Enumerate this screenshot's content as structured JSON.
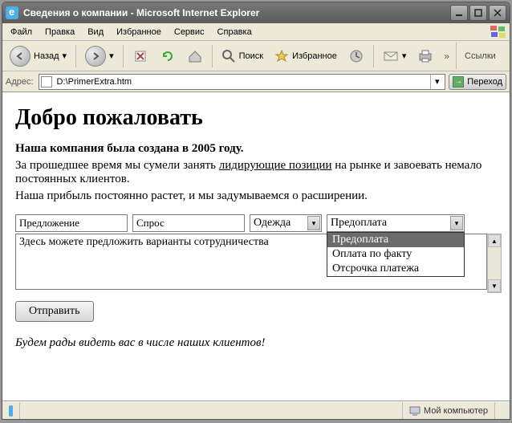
{
  "window": {
    "title": "Сведения о компании - Microsoft Internet Explorer"
  },
  "menu": {
    "file": "Файл",
    "edit": "Правка",
    "view": "Вид",
    "favorites": "Избранное",
    "service": "Сервис",
    "help": "Справка"
  },
  "toolbar": {
    "back": "Назад",
    "search": "Поиск",
    "favorites": "Избранное",
    "links": "Ссылки"
  },
  "address": {
    "label": "Адрес:",
    "value": "D:\\PrimerExtra.htm",
    "go": "Переход"
  },
  "page": {
    "heading": "Добро пожаловать",
    "sub_bold": "Наша компания была создана в 2005 году.",
    "line2a": "За прошедшее время мы сумели занять ",
    "line2u": "лидирующие позиции",
    "line2b": " на рынке и завоевать немало постоянных клиентов.",
    "line3": "Наша прибыль постоянно растет, и мы задумываемся о расширении.",
    "offer_value": "Предложение",
    "demand_value": "Спрос",
    "clothes_selected": "Одежда",
    "payment_selected": "Предоплата",
    "payment_options": [
      "Предоплата",
      "Оплата по факту",
      "Отсрочка платежа"
    ],
    "textarea_value": "Здесь можете предложить варианты сотрудничества",
    "submit": "Отправить",
    "italic_note": "Будем рады видеть вас в числе наших клиентов!"
  },
  "status": {
    "zone": "Мой компьютер"
  }
}
